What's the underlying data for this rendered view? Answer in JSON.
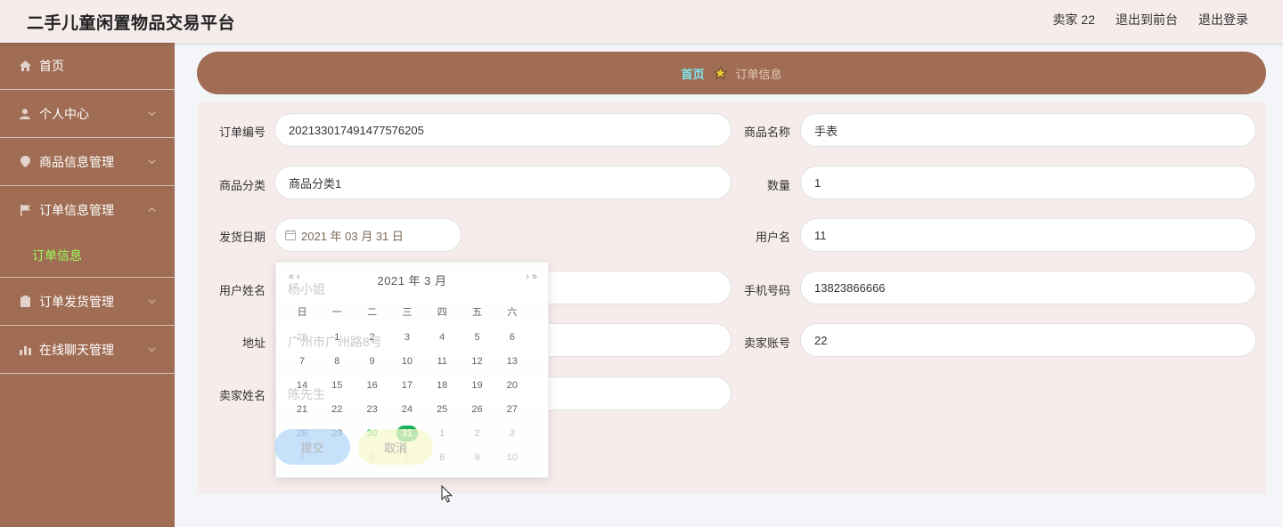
{
  "header": {
    "title": "二手儿童闲置物品交易平台",
    "user": "卖家 22",
    "to_front": "退出到前台",
    "logout": "退出登录"
  },
  "sidebar": {
    "items": [
      {
        "label": "首页",
        "icon": "home-icon"
      },
      {
        "label": "个人中心",
        "icon": "user-icon"
      },
      {
        "label": "商品信息管理",
        "icon": "location-icon"
      },
      {
        "label": "订单信息管理",
        "icon": "flag-icon"
      },
      {
        "label": "订单发货管理",
        "icon": "clipboard-icon"
      },
      {
        "label": "在线聊天管理",
        "icon": "bar-chart-icon"
      }
    ],
    "submenu_active": "订单信息"
  },
  "breadcrumb": {
    "home": "首页",
    "current": "订单信息"
  },
  "form": {
    "order_no_label": "订单编号",
    "order_no": "202133017491477576205",
    "product_name_label": "商品名称",
    "product_name": "手表",
    "category_label": "商品分类",
    "category": "商品分类1",
    "quantity_label": "数量",
    "quantity": "1",
    "ship_date_label": "发货日期",
    "ship_date": "2021 年 03 月 31 日",
    "username_label": "用户名",
    "username": "11",
    "real_name_label": "用户姓名",
    "real_name": "杨小姐",
    "phone_label": "手机号码",
    "phone": "13823866666",
    "address_label": "地址",
    "address": "广州市广州路8号",
    "seller_account_label": "卖家账号",
    "seller_account": "22",
    "seller_name_label": "卖家姓名",
    "seller_name": "陈先生",
    "submit": "提交",
    "cancel": "取消"
  },
  "datepicker": {
    "title": "2021 年  3 月",
    "prev": "« ‹",
    "next": "› »",
    "weekdays": [
      "日",
      "一",
      "二",
      "三",
      "四",
      "五",
      "六"
    ],
    "weeks": [
      [
        "28",
        "1",
        "2",
        "3",
        "4",
        "5",
        "6"
      ],
      [
        "7",
        "8",
        "9",
        "10",
        "11",
        "12",
        "13"
      ],
      [
        "14",
        "15",
        "16",
        "17",
        "18",
        "19",
        "20"
      ],
      [
        "21",
        "22",
        "23",
        "24",
        "25",
        "26",
        "27"
      ],
      [
        "28",
        "29",
        "30",
        "31",
        "1",
        "2",
        "3"
      ],
      [
        "4",
        "5",
        "6",
        "7",
        "8",
        "9",
        "10"
      ]
    ],
    "today": "30",
    "selected": "31"
  },
  "colors": {
    "brand": "#a06d54",
    "header_bg": "#f6eceb",
    "active_submenu": "#9bff5a",
    "selected_day": "#1aaf5d"
  }
}
